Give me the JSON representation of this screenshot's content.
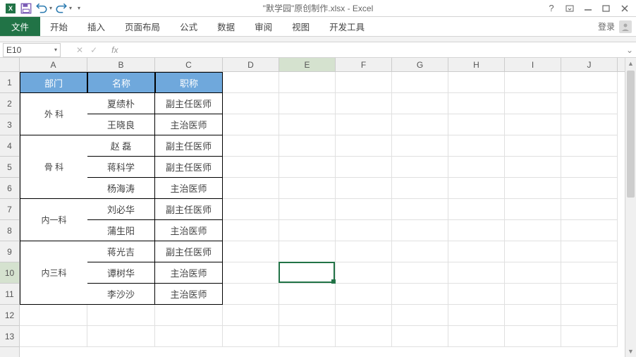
{
  "title": "\"默学园\"原创制作.xlsx - Excel",
  "login": "登录",
  "help": "?",
  "tabs": {
    "file": "文件",
    "home": "开始",
    "insert": "插入",
    "layout": "页面布局",
    "formulas": "公式",
    "data": "数据",
    "review": "审阅",
    "view": "视图",
    "dev": "开发工具"
  },
  "nameBox": "E10",
  "fxCancel": "✕",
  "fxConfirm": "✓",
  "fxLabel": "fx",
  "cols": [
    "A",
    "B",
    "C",
    "D",
    "E",
    "F",
    "G",
    "H",
    "I",
    "J"
  ],
  "rows": [
    "1",
    "2",
    "3",
    "4",
    "5",
    "6",
    "7",
    "8",
    "9",
    "10",
    "11",
    "12",
    "13"
  ],
  "activeCell": {
    "row": 10,
    "col": "E"
  },
  "headers": {
    "dept": "部门",
    "name": "名称",
    "title": "职称"
  },
  "data": [
    {
      "dept": "外 科",
      "span": 2,
      "rows": [
        {
          "name": "夏绩朴",
          "title": "副主任医师"
        },
        {
          "name": "王晓良",
          "title": "主治医师"
        }
      ]
    },
    {
      "dept": "骨 科",
      "span": 3,
      "rows": [
        {
          "name": "赵 磊",
          "title": "副主任医师"
        },
        {
          "name": "蒋科学",
          "title": "副主任医师"
        },
        {
          "name": "杨海涛",
          "title": "主治医师"
        }
      ]
    },
    {
      "dept": "内一科",
      "span": 2,
      "rows": [
        {
          "name": "刘必华",
          "title": "副主任医师"
        },
        {
          "name": "蒲生阳",
          "title": "主治医师"
        }
      ]
    },
    {
      "dept": "内三科",
      "span": 3,
      "rows": [
        {
          "name": "蒋光吉",
          "title": "副主任医师"
        },
        {
          "name": "谭树华",
          "title": "主治医师"
        },
        {
          "name": "李沙沙",
          "title": "主治医师"
        }
      ]
    }
  ]
}
